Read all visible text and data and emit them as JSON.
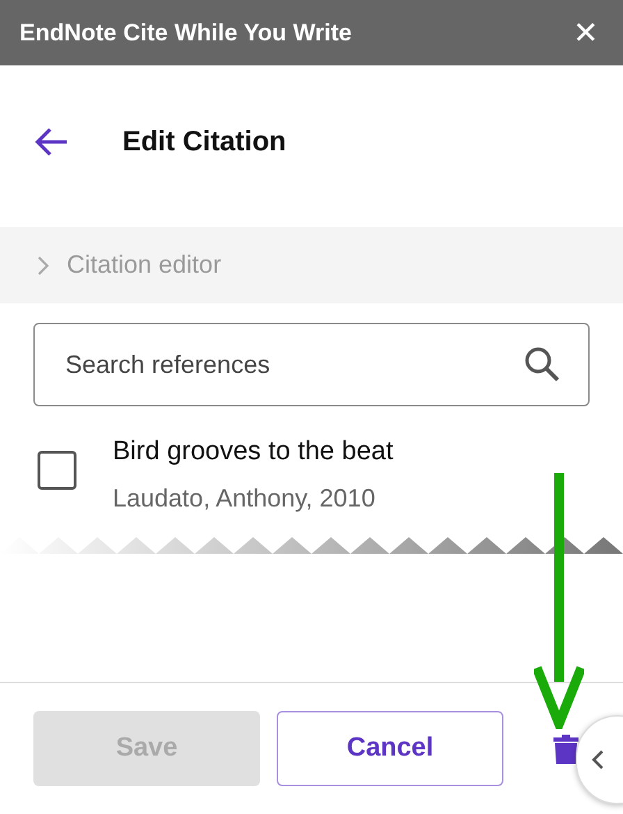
{
  "window": {
    "title": "EndNote Cite While You Write",
    "close": "✕"
  },
  "header": {
    "title": "Edit Citation"
  },
  "section": {
    "label": "Citation editor",
    "expanded": false
  },
  "search": {
    "placeholder": "Search references"
  },
  "references": [
    {
      "title": "Bird grooves to the beat",
      "authors": "Laudato, Anthony, 2010",
      "checked": false
    }
  ],
  "buttons": [
    {
      "label": "Save",
      "disabled": true
    },
    {
      "label": "Cancel",
      "disabled": false
    }
  ]
}
